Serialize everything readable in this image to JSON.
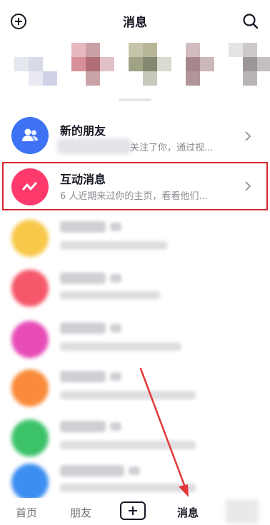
{
  "header": {
    "title": "消息",
    "add_icon": "plus-circle-icon",
    "search_icon": "search-icon"
  },
  "messages": [
    {
      "name": "新的朋友",
      "preview": "关注了你，通过视...",
      "icon": "people-icon",
      "color": "#3d72f5"
    },
    {
      "name": "互动消息",
      "preview": "6 人近期来过你的主页，看看他们...",
      "icon": "wave-icon",
      "color": "#fd3a6b"
    }
  ],
  "blurred_rows": [
    {
      "color": "#f7c84a"
    },
    {
      "color": "#f5586a"
    },
    {
      "color": "#e84db7"
    },
    {
      "color": "#f98b3a"
    },
    {
      "color": "#3cc36a"
    },
    {
      "color": "#3c8ef0"
    }
  ],
  "bottom_nav": {
    "home": "首页",
    "friends": "朋友",
    "messages": "消息",
    "add_icon": "plus-icon"
  },
  "colors": {
    "highlight_border": "#d9262c",
    "annotation_arrow": "#e2383a"
  }
}
